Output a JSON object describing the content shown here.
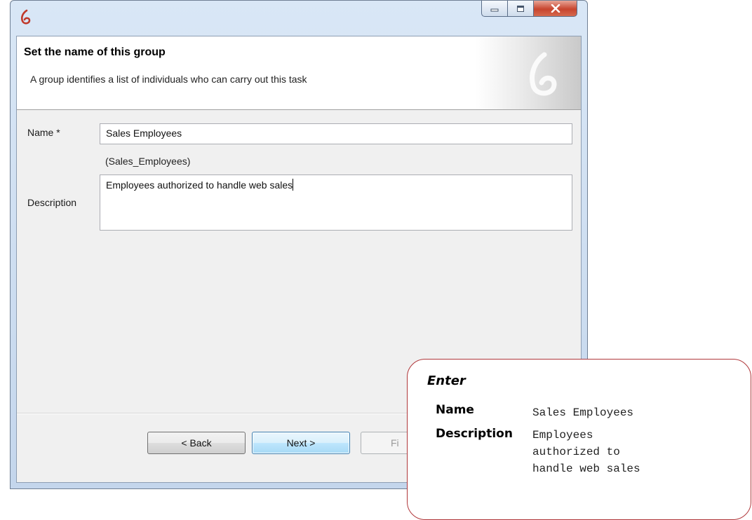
{
  "dialog": {
    "header": {
      "title": "Set the name of this group",
      "subtitle": "A group identifies a list of individuals who can carry out this task"
    },
    "form": {
      "name_label": "Name *",
      "name_value": "Sales Employees",
      "name_identifier": "(Sales_Employees)",
      "description_label": "Description",
      "description_value": "Employees authorized to handle web sales"
    },
    "buttons": {
      "back": "< Back",
      "next": "Next >",
      "finish": "Fi"
    }
  },
  "callout": {
    "title": "Enter",
    "name_label": "Name",
    "name_value": "Sales Employees",
    "description_label": "Description",
    "description_value": "Employees\nauthorized to\nhandle web sales"
  },
  "colors": {
    "callout_border": "#b0373a",
    "logo": "#c0392b",
    "primary_button": "#3c7fb1"
  },
  "icons": {
    "app_logo": "windev-logo-icon",
    "minimize": "minimize-icon",
    "maximize": "maximize-icon",
    "close": "close-icon"
  }
}
